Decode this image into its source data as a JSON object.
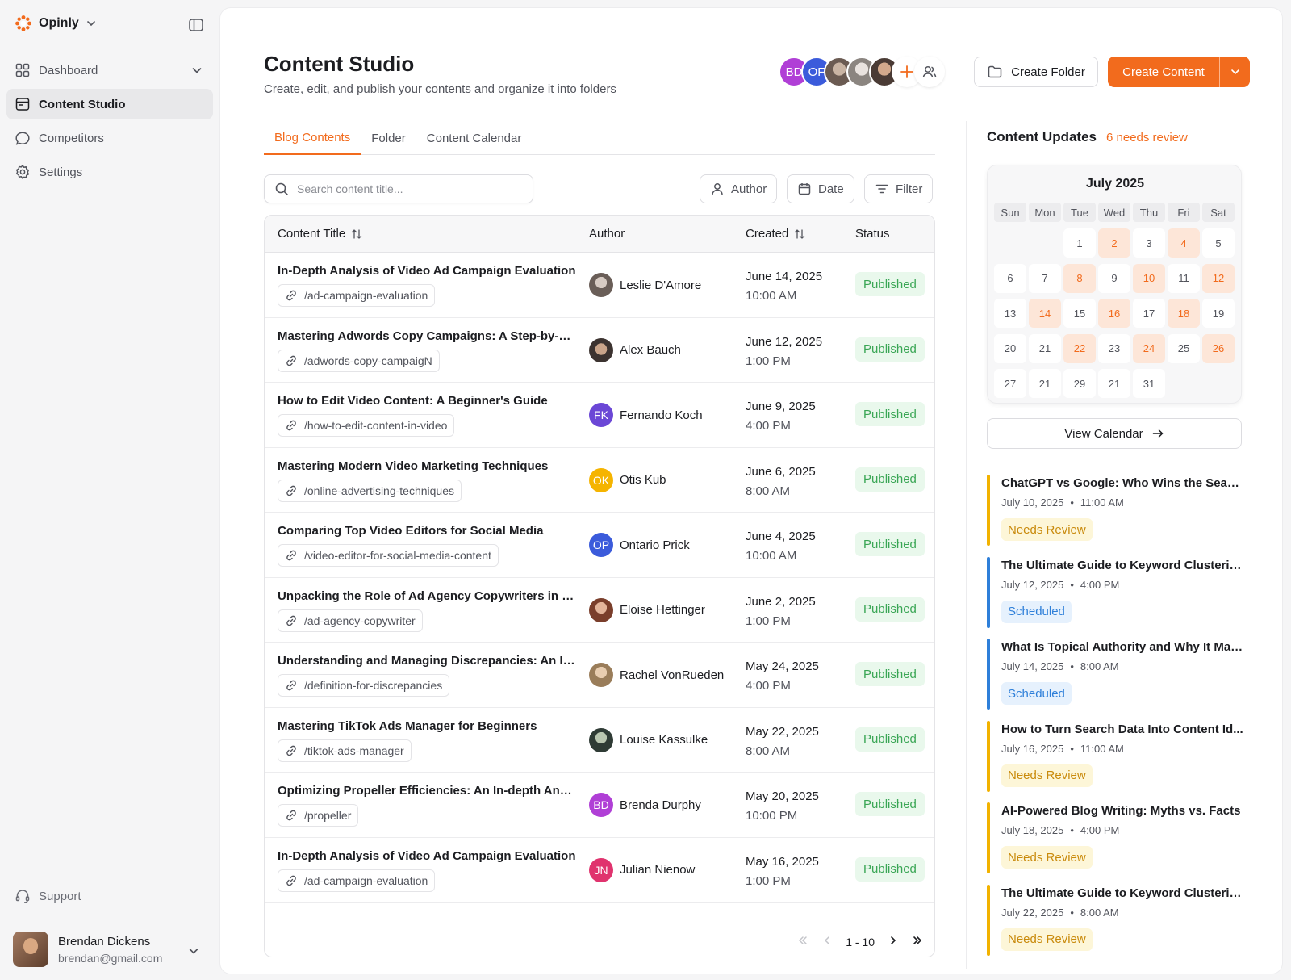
{
  "app": {
    "name": "Opinly"
  },
  "nav": {
    "items": [
      {
        "label": "Dashboard"
      },
      {
        "label": "Content Studio"
      },
      {
        "label": "Competitors"
      },
      {
        "label": "Settings"
      }
    ],
    "support": "Support"
  },
  "user": {
    "name": "Brendan Dickens",
    "email": "brendan@gmail.com"
  },
  "header": {
    "title": "Content Studio",
    "subtitle": "Create, edit, and publish your contents and organize it into folders",
    "collaborators": [
      "BD",
      "OF"
    ],
    "create_folder": "Create Folder",
    "create_content": "Create Content"
  },
  "tabs": [
    "Blog Contents",
    "Folder",
    "Content Calendar"
  ],
  "search": {
    "placeholder": "Search content title..."
  },
  "filters": {
    "author": "Author",
    "date": "Date",
    "filter": "Filter"
  },
  "table": {
    "columns": {
      "title": "Content Title",
      "author": "Author",
      "created": "Created",
      "status": "Status"
    },
    "rows": [
      {
        "title": "In-Depth Analysis of Video Ad Campaign Evaluation",
        "slug": "/ad-campaign-evaluation",
        "author": "Leslie D'Amore",
        "initials": "",
        "date": "June 14, 2025",
        "time": "10:00 AM",
        "status": "Published"
      },
      {
        "title": "Mastering Adwords Copy Campaigns: A Step-by-Ste...",
        "slug": "/adwords-copy-campaigN",
        "author": "Alex Bauch",
        "initials": "",
        "date": "June 12, 2025",
        "time": "1:00 PM",
        "status": "Published"
      },
      {
        "title": "How to Edit Video Content: A Beginner's Guide",
        "slug": "/how-to-edit-content-in-video",
        "author": "Fernando Koch",
        "initials": "FK",
        "date": "June 9, 2025",
        "time": "4:00 PM",
        "status": "Published"
      },
      {
        "title": "Mastering Modern Video Marketing Techniques",
        "slug": "/online-advertising-techniques",
        "author": "Otis Kub",
        "initials": "OK",
        "date": "June 6, 2025",
        "time": "8:00 AM",
        "status": "Published"
      },
      {
        "title": "Comparing Top Video Editors for Social Media",
        "slug": "/video-editor-for-social-media-content",
        "author": "Ontario Prick",
        "initials": "OP",
        "date": "June 4, 2025",
        "time": "10:00 AM",
        "status": "Published"
      },
      {
        "title": "Unpacking the Role of Ad Agency Copywriters in Mo...",
        "slug": "/ad-agency-copywriter",
        "author": "Eloise Hettinger",
        "initials": "",
        "date": "June 2, 2025",
        "time": "1:00 PM",
        "status": "Published"
      },
      {
        "title": "Understanding and Managing Discrepancies: An In-...",
        "slug": "/definition-for-discrepancies",
        "author": "Rachel VonRueden",
        "initials": "",
        "date": "May 24, 2025",
        "time": "4:00 PM",
        "status": "Published"
      },
      {
        "title": "Mastering TikTok Ads Manager for Beginners",
        "slug": "/tiktok-ads-manager",
        "author": "Louise Kassulke",
        "initials": "",
        "date": "May 22, 2025",
        "time": "8:00 AM",
        "status": "Published"
      },
      {
        "title": "Optimizing Propeller Efficiencies: An In-depth Analysis",
        "slug": "/propeller",
        "author": "Brenda Durphy",
        "initials": "BD",
        "date": "May 20, 2025",
        "time": "10:00 PM",
        "status": "Published"
      },
      {
        "title": "In-Depth Analysis of Video Ad Campaign Evaluation",
        "slug": "/ad-campaign-evaluation",
        "author": "Julian Nienow",
        "initials": "JN",
        "date": "May 16, 2025",
        "time": "1:00 PM",
        "status": "Published"
      }
    ],
    "pager": "1 - 10"
  },
  "updates": {
    "title": "Content Updates",
    "count": "6 needs review",
    "calendar": {
      "month": "July 2025",
      "weekdays": [
        "Sun",
        "Mon",
        "Tue",
        "Wed",
        "Thu",
        "Fri",
        "Sat"
      ],
      "days": [
        "",
        "",
        "1",
        "2",
        "3",
        "4",
        "5",
        "6",
        "7",
        "8",
        "9",
        "10",
        "11",
        "12",
        "13",
        "14",
        "15",
        "16",
        "17",
        "18",
        "19",
        "20",
        "21",
        "22",
        "23",
        "24",
        "25",
        "26",
        "27",
        "21",
        "29",
        "21",
        "31"
      ],
      "highlighted": [
        "2",
        "4",
        "8",
        "10",
        "12",
        "14",
        "16",
        "18",
        "22",
        "24",
        "26"
      ]
    },
    "view_calendar": "View Calendar",
    "items": [
      {
        "title": "ChatGPT vs Google: Who Wins the Searc...",
        "date": "July 10, 2025",
        "time": "11:00 AM",
        "tag": "Needs Review",
        "kind": "review"
      },
      {
        "title": "The Ultimate Guide to Keyword Clustering",
        "date": "July 12, 2025",
        "time": "4:00 PM",
        "tag": "Scheduled",
        "kind": "scheduled"
      },
      {
        "title": "What Is Topical Authority and Why It Mat...",
        "date": "July 14, 2025",
        "time": "8:00 AM",
        "tag": "Scheduled",
        "kind": "scheduled"
      },
      {
        "title": "How to Turn Search Data Into Content Id...",
        "date": "July 16, 2025",
        "time": "11:00 AM",
        "tag": "Needs Review",
        "kind": "review"
      },
      {
        "title": "AI-Powered Blog Writing: Myths vs. Facts",
        "date": "July 18, 2025",
        "time": "4:00 PM",
        "tag": "Needs Review",
        "kind": "review"
      },
      {
        "title": "The Ultimate Guide to Keyword Clustering",
        "date": "July 22, 2025",
        "time": "8:00 AM",
        "tag": "Needs Review",
        "kind": "review"
      }
    ]
  },
  "colors": {
    "accent": "#f26b1d",
    "published": "#3aa655",
    "review": "#f2b200",
    "scheduled": "#2e7fd9"
  }
}
